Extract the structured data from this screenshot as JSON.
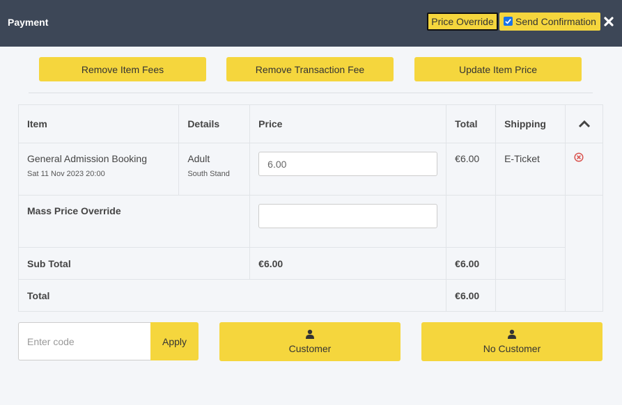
{
  "header": {
    "title": "Payment",
    "price_override_label": "Price Override",
    "send_confirmation_label": "Send Confirmation",
    "send_confirmation_checked": true
  },
  "actions": {
    "remove_item_fees": "Remove Item Fees",
    "remove_transaction_fee": "Remove Transaction Fee",
    "update_item_price": "Update Item Price"
  },
  "table": {
    "columns": [
      "Item",
      "Details",
      "Price",
      "Total",
      "Shipping"
    ],
    "items": [
      {
        "name": "General Admission Booking",
        "datetime": "Sat 11 Nov 2023 20:00",
        "detail": "Adult",
        "area": "South Stand",
        "price": "6.00",
        "total": "€6.00",
        "shipping": "E-Ticket"
      }
    ],
    "mass_override_label": "Mass Price Override",
    "mass_override_value": "",
    "subtotal_label": "Sub Total",
    "subtotal_price": "€6.00",
    "subtotal_total": "€6.00",
    "total_label": "Total",
    "total_value": "€6.00"
  },
  "bottom": {
    "code_placeholder": "Enter code",
    "apply_label": "Apply",
    "customer_label": "Customer",
    "no_customer_label": "No Customer"
  },
  "colors": {
    "header_bg": "#3d4757",
    "accent": "#f5d63d",
    "remove_icon": "#d9534f"
  }
}
